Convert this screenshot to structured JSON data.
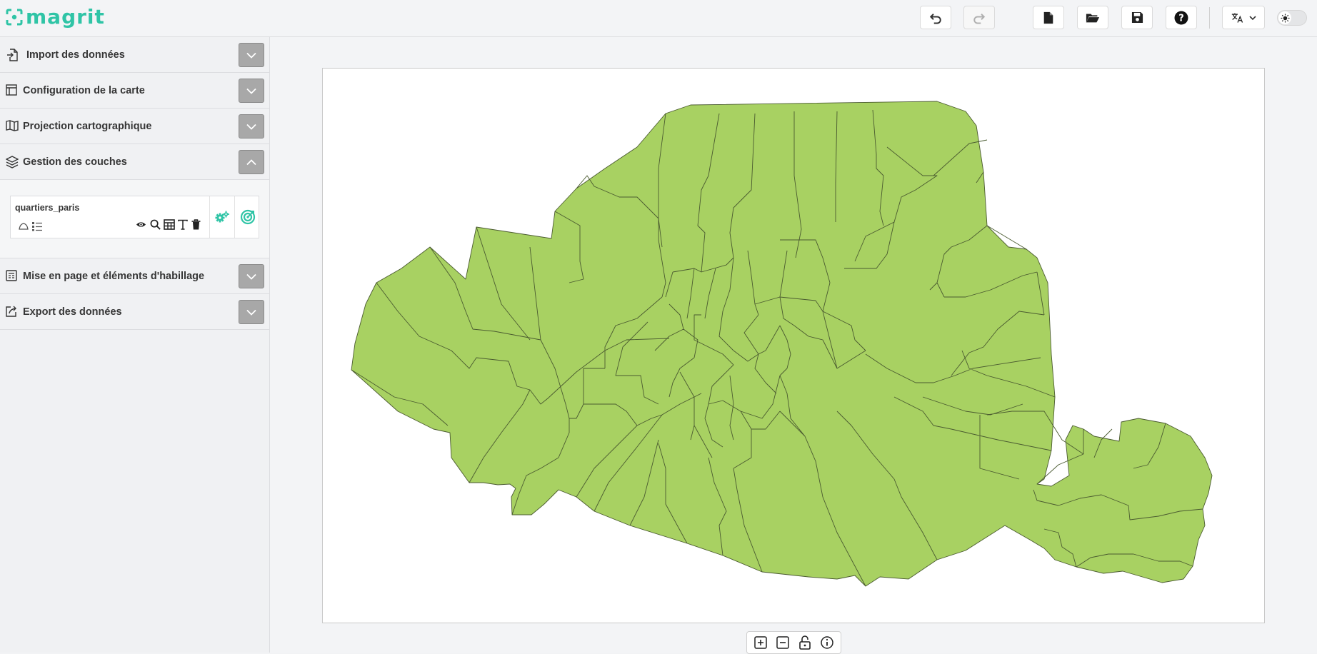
{
  "app": {
    "name": "magrit",
    "accent": "#2fc4a6"
  },
  "header": {
    "buttons": [
      {
        "name": "undo",
        "icon": "undo-icon",
        "enabled": true
      },
      {
        "name": "redo",
        "icon": "redo-icon",
        "enabled": false
      },
      {
        "name": "new-project",
        "icon": "file-icon",
        "enabled": true
      },
      {
        "name": "open-project",
        "icon": "folder-open-icon",
        "enabled": true
      },
      {
        "name": "save-project",
        "icon": "save-icon",
        "enabled": true
      },
      {
        "name": "help",
        "icon": "question-circle-icon",
        "enabled": true
      }
    ],
    "language_selector": {
      "icon": "translate-icon"
    },
    "theme_toggle": {
      "state": "light",
      "icon": "sun-icon"
    }
  },
  "sidebar": {
    "sections": [
      {
        "id": "import",
        "title": "Import des données",
        "icon": "file-import-icon",
        "expanded": false
      },
      {
        "id": "config",
        "title": "Configuration de la carte",
        "icon": "layout-icon",
        "expanded": false
      },
      {
        "id": "projection",
        "title": "Projection cartographique",
        "icon": "map-icon",
        "expanded": false
      },
      {
        "id": "layers",
        "title": "Gestion des couches",
        "icon": "layers-icon",
        "expanded": true
      },
      {
        "id": "layout",
        "title": "Mise en page et éléments d'habillage",
        "icon": "newspaper-icon",
        "expanded": false
      },
      {
        "id": "export",
        "title": "Export des données",
        "icon": "export-icon",
        "expanded": false
      }
    ],
    "layers": [
      {
        "name": "quartiers_paris",
        "geometry_icon": "polygon-icon",
        "legend_icon": "legend-list-icon",
        "actions": [
          "eye-icon",
          "search-icon",
          "table-icon",
          "text-icon",
          "trash-icon"
        ],
        "side_actions": [
          "cogs-icon",
          "target-icon"
        ]
      }
    ]
  },
  "map": {
    "fill_color": "#a8d162",
    "stroke_color": "#4a5a30",
    "background": "#ffffff",
    "controls": [
      "zoom-in-icon",
      "zoom-out-icon",
      "unlock-icon",
      "info-icon"
    ]
  }
}
